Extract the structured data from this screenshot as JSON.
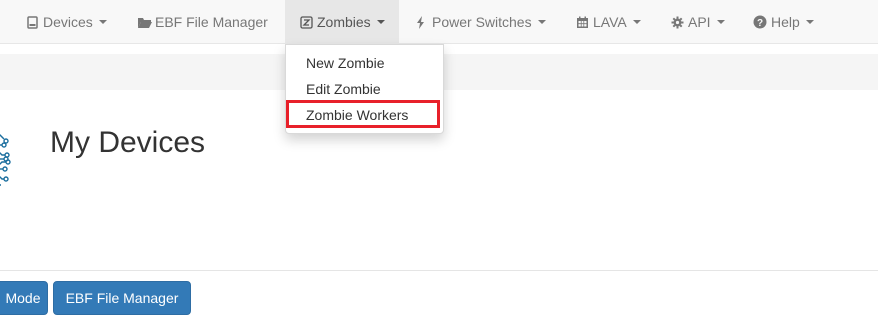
{
  "navbar": {
    "items": [
      {
        "label": "Devices",
        "icon": "hdd-icon"
      },
      {
        "label": "EBF File Manager",
        "icon": "folder-open-icon"
      },
      {
        "label": "Zombies",
        "icon": "zombie-logo-icon"
      },
      {
        "label": "Power Switches",
        "icon": "flash-icon"
      },
      {
        "label": "LAVA",
        "icon": "calendar-icon"
      },
      {
        "label": "API",
        "icon": "cog-icon"
      },
      {
        "label": "Help",
        "icon": "question-sign-icon"
      }
    ]
  },
  "dropdown": {
    "items": [
      {
        "label": "New Zombie"
      },
      {
        "label": "Edit Zombie"
      },
      {
        "label": "Zombie Workers"
      }
    ],
    "highlight_color": "#e8202a"
  },
  "page": {
    "title": "My Devices",
    "title_icon": "circuit-chip-icon"
  },
  "actions": {
    "mode_label": "Mode",
    "ebf_label": "EBF File Manager"
  },
  "colors": {
    "primary_button": "#337ab7",
    "navbar_bg": "#f8f8f8",
    "navbar_active_bg": "#e7e7e7",
    "chip_icon": "#1b6e9e"
  }
}
